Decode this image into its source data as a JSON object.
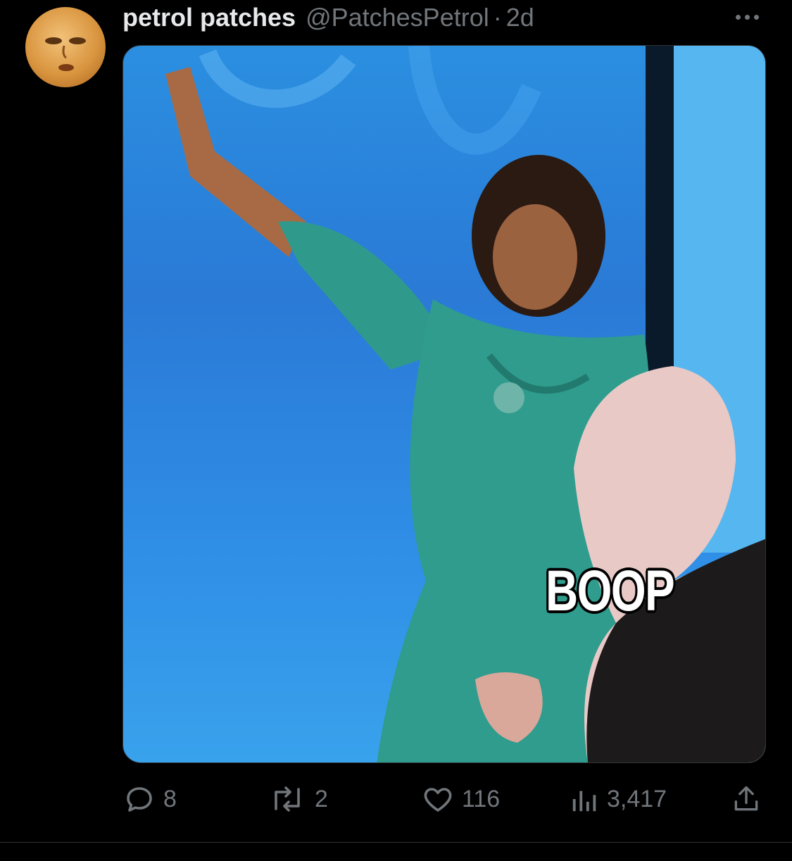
{
  "tweet": {
    "author_name": "petrol patches",
    "handle": "@PatchesPetrol",
    "separator": "·",
    "time": "2d",
    "media": {
      "caption_text": "BOOP"
    },
    "stats": {
      "replies": "8",
      "reposts": "2",
      "likes": "116",
      "views": "3,417"
    }
  },
  "colors": {
    "background": "#000000",
    "text_primary": "#e7e9ea",
    "text_secondary": "#71767b"
  },
  "icons": [
    "reply-icon",
    "repost-icon",
    "like-icon",
    "views-icon",
    "share-icon",
    "more-icon"
  ]
}
